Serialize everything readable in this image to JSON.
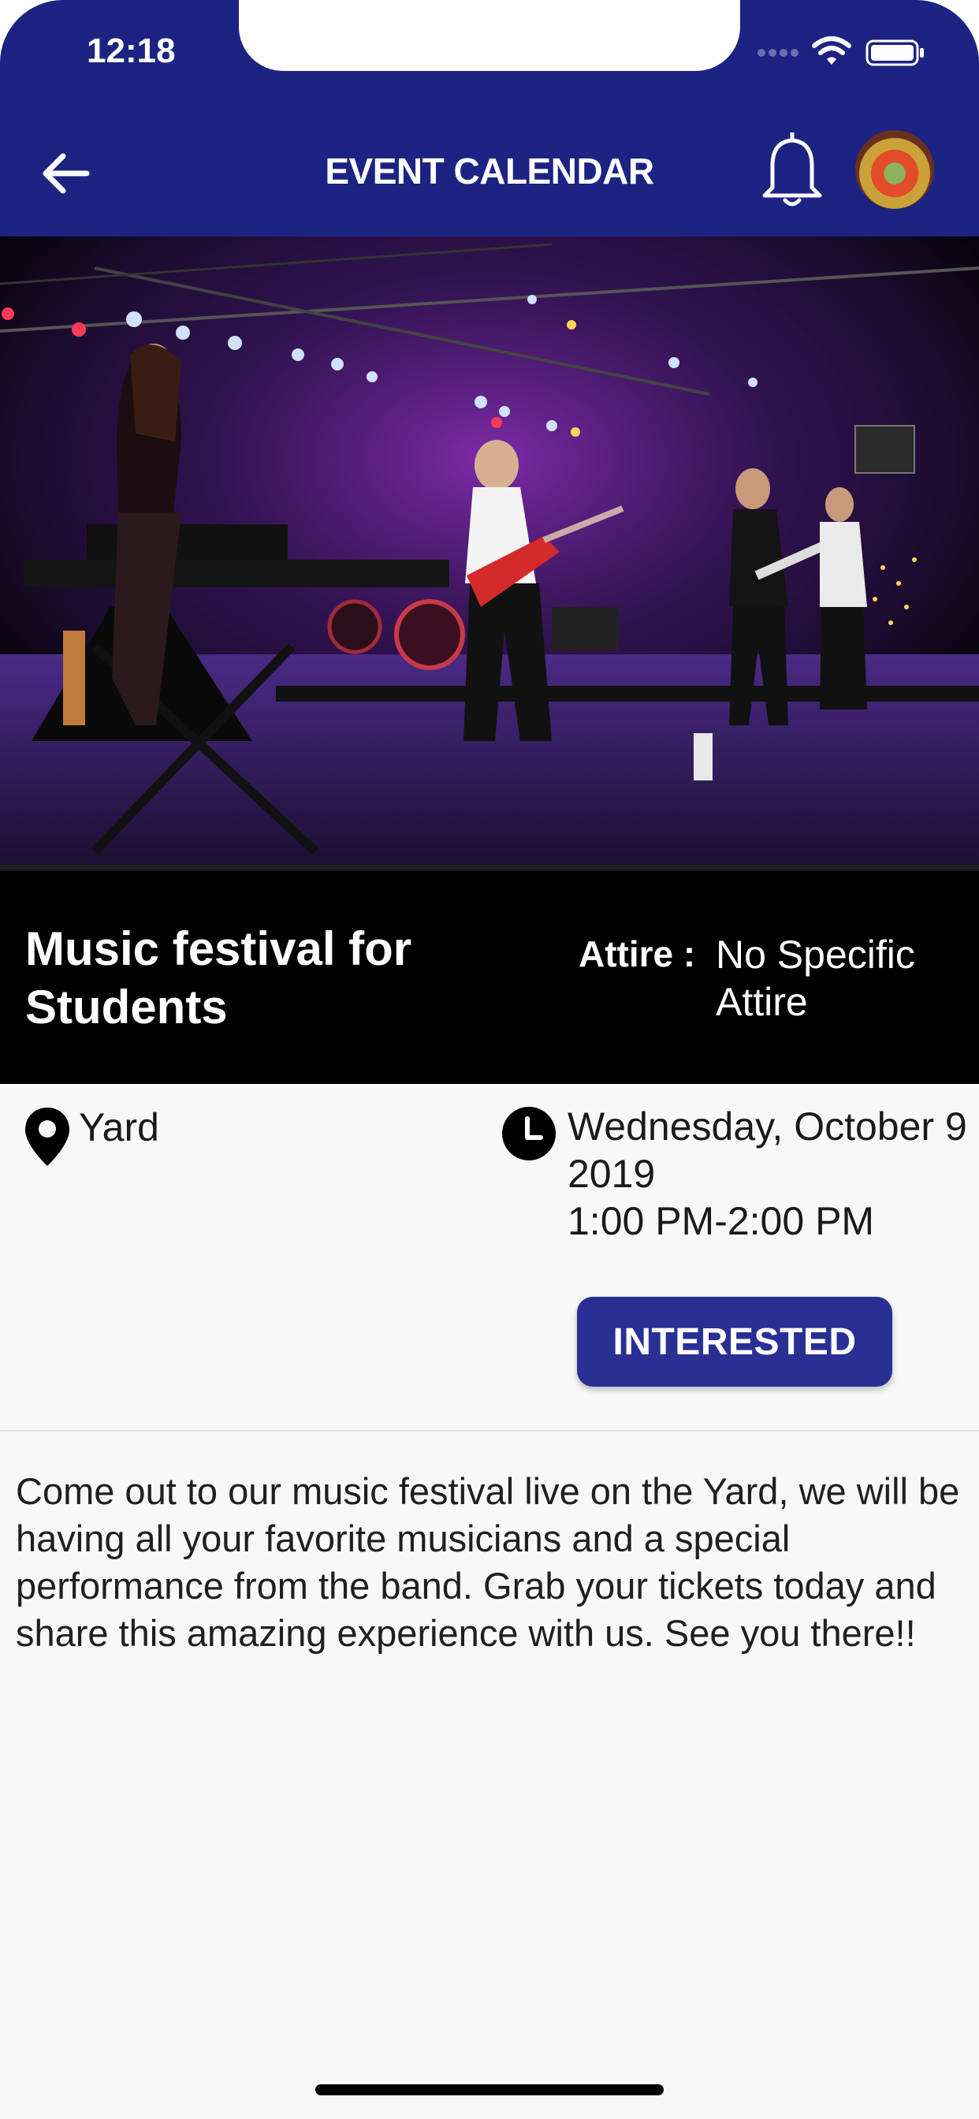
{
  "status_bar": {
    "time": "12:18"
  },
  "app_bar": {
    "title": "EVENT CALENDAR",
    "back_icon": "arrow-left-icon",
    "bell_icon": "bell-icon",
    "avatar": "profile-avatar"
  },
  "event": {
    "title": "Music festival for Students",
    "attire_label": "Attire :",
    "attire_value": "No Specific Attire",
    "location": "Yard",
    "date": "Wednesday, October 9 2019",
    "time": "1:00 PM-2:00 PM",
    "interested_label": "INTERESTED",
    "description": "Come out to our music festival live on the Yard, we will be having all your favorite musicians and a special performance from the band. Grab your tickets today and share this amazing experience with us. See you there!!"
  },
  "colors": {
    "brand": "#1c2382",
    "button": "#2a2f94",
    "band": "#000000",
    "background": "#f8f8f8"
  }
}
